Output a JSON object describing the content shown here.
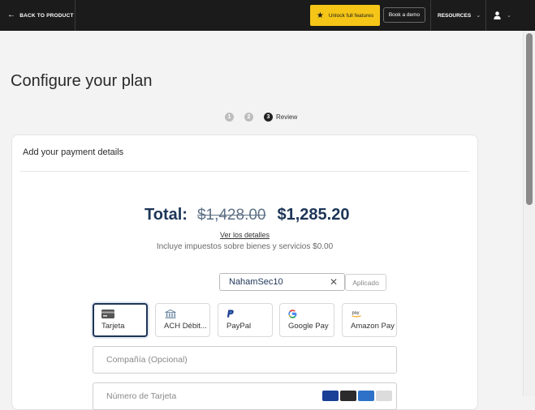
{
  "topbar": {
    "back_label": "BACK TO PRODUCT",
    "unlock_label": "Unlock full features",
    "demo_label": "Book a demo",
    "resources_label": "RESOURCES"
  },
  "page": {
    "title": "Configure your plan"
  },
  "steps": {
    "items": [
      "1",
      "2",
      "3"
    ],
    "current_label": "Review"
  },
  "payment": {
    "heading": "Add your payment details",
    "total_label": "Total:",
    "total_original": "$1,428.00",
    "total_discounted": "$1,285.20",
    "details_link": "Ver los detalles",
    "tax_line": "Incluye impuestos sobre bienes y servicios $0.00",
    "promo_code": "NahamSec10",
    "applied_label": "Aplicado",
    "methods": [
      "Tarjeta",
      "ACH Débit...",
      "PayPal",
      "Google Pay",
      "Amazon Pay"
    ],
    "company_placeholder": "Compañía (Opcional)",
    "card_number_placeholder": "Número de Tarjeta"
  },
  "colors": {
    "accent": "#f5c518",
    "topbar": "#1b1b1b",
    "price": "#1d3557"
  }
}
